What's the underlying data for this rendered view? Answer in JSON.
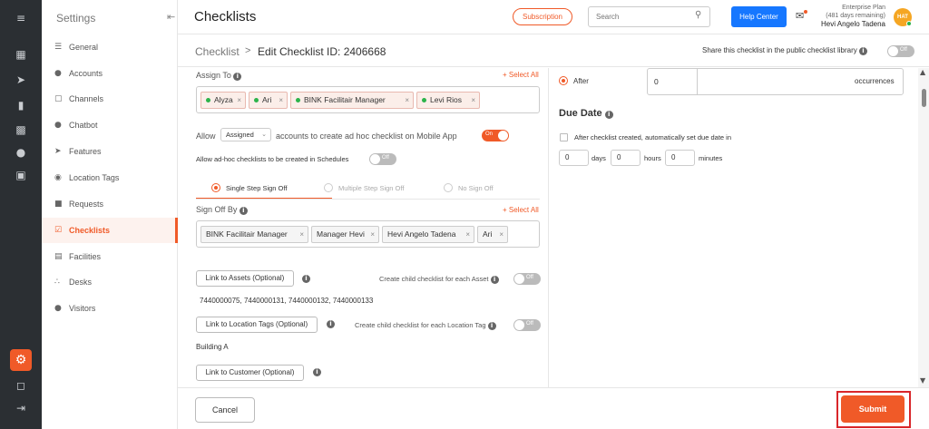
{
  "rail": {
    "icons": [
      "menu-icon",
      "dashboard-icon",
      "rocket-icon",
      "chart-icon",
      "analytics-icon",
      "chat-icon",
      "copy-icon",
      "settings-icon",
      "box-icon",
      "logout-icon"
    ]
  },
  "sidebar": {
    "title": "Settings",
    "collapse_icon": "collapse-icon",
    "items": [
      {
        "label": "General",
        "icon": "sliders-icon"
      },
      {
        "label": "Accounts",
        "icon": "users-icon"
      },
      {
        "label": "Channels",
        "icon": "channels-icon"
      },
      {
        "label": "Chatbot",
        "icon": "chatbot-icon"
      },
      {
        "label": "Features",
        "icon": "rocket-icon"
      },
      {
        "label": "Location Tags",
        "icon": "pin-icon"
      },
      {
        "label": "Requests",
        "icon": "requests-icon"
      },
      {
        "label": "Checklists",
        "icon": "checklist-icon",
        "active": true
      },
      {
        "label": "Facilities",
        "icon": "facilities-icon"
      },
      {
        "label": "Desks",
        "icon": "desk-icon"
      },
      {
        "label": "Visitors",
        "icon": "visitors-icon"
      }
    ]
  },
  "topbar": {
    "title": "Checklists",
    "subscription_label": "Subscription",
    "search_placeholder": "Search",
    "help_label": "Help Center",
    "plan_line1": "Enterprise Plan",
    "plan_line2": "(481 days remaining)",
    "user_name": "Hevi Angelo Tadena",
    "avatar_initials": "HAT"
  },
  "breadcrumb": {
    "root": "Checklist",
    "separator": ">",
    "current": "Edit Checklist ID: 2406668",
    "share_label": "Share this checklist in the public checklist library",
    "share_toggle": "Off"
  },
  "form": {
    "assign_to_label": "Assign To",
    "select_all": "+ Select All",
    "assignees": [
      "Alyza",
      "Ari",
      "BINK Facilitair Manager",
      "Levi Rios"
    ],
    "allow_label": "Allow",
    "allow_select": "Assigned",
    "allow_suffix": "accounts to create ad hoc checklist on Mobile App",
    "allow_toggle": "On",
    "schedules_label": "Allow ad-hoc checklists to be created in Schedules",
    "schedules_toggle": "Off",
    "signoff_options": [
      "Single Step Sign Off",
      "Multiple Step Sign Off",
      "No Sign Off"
    ],
    "signoff_by_label": "Sign Off By",
    "signoff_select_all": "+ Select All",
    "signoff_people": [
      "BINK Facilitair Manager",
      "Manager Hevi",
      "Hevi Angelo Tadena",
      "Ari"
    ],
    "assets_button": "Link to Assets (Optional)",
    "child_asset_label": "Create child checklist for each Asset",
    "child_asset_toggle": "Off",
    "assets_value": "7440000075, 7440000131, 7440000132, 7440000133",
    "location_button": "Link to Location Tags (Optional)",
    "child_location_label": "Create child checklist for each Location Tag",
    "child_location_toggle": "Off",
    "location_value": "Building A",
    "customer_button": "Link to Customer (Optional)"
  },
  "right": {
    "after_label": "After",
    "after_value": "0",
    "occurrences_label": "occurrences",
    "due_date_title": "Due Date",
    "auto_due_label": "After checklist created, automatically set due date in",
    "days_value": "0",
    "days_label": "days",
    "hours_value": "0",
    "hours_label": "hours",
    "minutes_value": "0",
    "minutes_label": "minutes"
  },
  "footer": {
    "cancel_label": "Cancel",
    "submit_label": "Submit"
  }
}
